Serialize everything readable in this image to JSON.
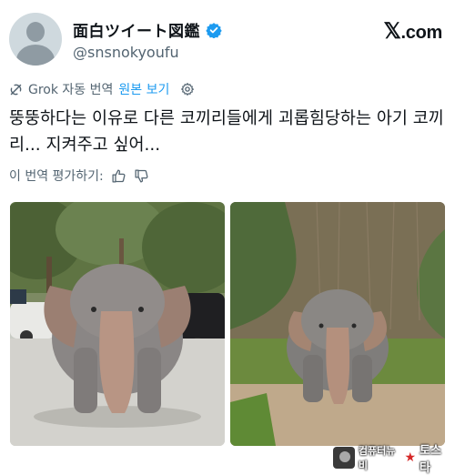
{
  "header": {
    "display_name": "面白ツイート図鑑",
    "handle": "@snsnokyoufu",
    "site_logo_x": "𝕏",
    "site_logo_text": ".com"
  },
  "translation": {
    "grok_label": "Grok 자동 번역",
    "show_original": "원본 보기"
  },
  "tweet": {
    "text": "뚱뚱하다는 이유로 다른 코끼리들에게 괴롭힘당하는 아기 코끼리... 지켜주고 싶어..."
  },
  "rating": {
    "label": "이 번역 평가하기:"
  },
  "watermark": {
    "text": "컴퓨터뉴비",
    "right": "토스타"
  },
  "colors": {
    "accent": "#1d9bf0",
    "secondary_text": "#536471",
    "text": "#0f1419"
  },
  "icons": [
    "verified-badge-icon",
    "grok-icon",
    "gear-icon",
    "thumbs-up-icon",
    "thumbs-down-icon"
  ]
}
